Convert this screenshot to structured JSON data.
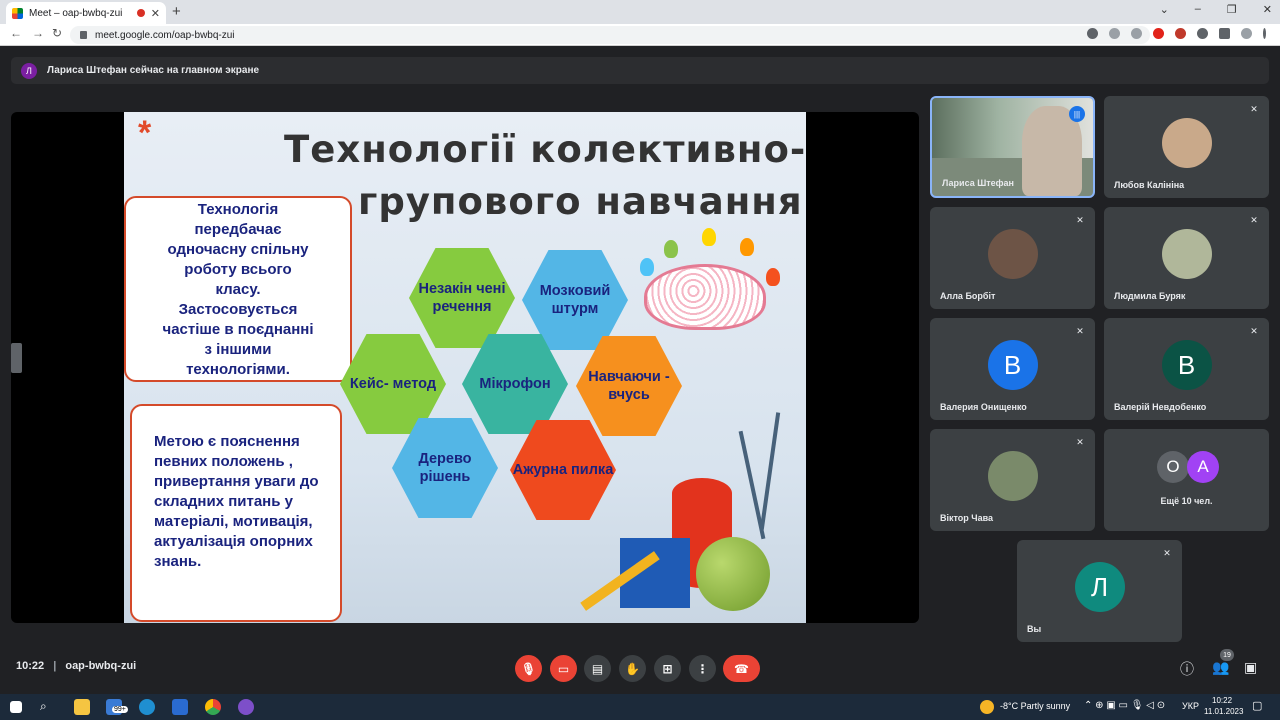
{
  "browser": {
    "tab_title": "Meet – oap-bwbq-zui",
    "tab_close": "✕",
    "new_tab": "+",
    "url": "meet.google.com/oap-bwbq-zui",
    "window_controls": [
      "⌄",
      "–",
      "❐",
      "✕"
    ]
  },
  "banner": {
    "avatar_letter": "Л",
    "text": "Лариса Штефан сейчас на главном экране"
  },
  "slide": {
    "title_line1": "Технології колективно-",
    "title_line2": "групового навчання",
    "panel1": [
      "Технологія",
      "передбачає",
      "одночасну спільну",
      "роботу  всього",
      "класу.",
      "Застосовується",
      "частіше в поєднанні",
      "з іншими",
      "технологіями."
    ],
    "panel2": [
      "Метою є пояснення",
      "певних положень ,",
      "привертання уваги до",
      "складних питань у",
      "матеріалі, мотивація,",
      "актуалізація опорних",
      "знань."
    ],
    "hexagons": [
      "Незакін чені речення",
      "Мозковий штурм",
      "Кейс- метод",
      "Мікрофон",
      "Навчаючи - вчусь",
      "Дерево рішень",
      "Ажурна пилка"
    ]
  },
  "participants": [
    {
      "name": "Лариса Штефан",
      "avatar": "",
      "color": "#9e8b7a"
    },
    {
      "name": "Любов Калініна",
      "avatar": "",
      "color": "#c9a98a"
    },
    {
      "name": "Алла Борбіт",
      "avatar": "",
      "color": "#6d5446"
    },
    {
      "name": "Людмила Буряк",
      "avatar": "",
      "color": "#b0b79a"
    },
    {
      "name": "Валерия Онищенко",
      "avatar": "B",
      "color": "#1a73e8"
    },
    {
      "name": "Валерій Невдобенко",
      "avatar": "B",
      "color": "#0b5345"
    },
    {
      "name": "Віктор Чава",
      "avatar": "",
      "color": "#7a8a6a"
    },
    {
      "name": "Ещё 10 чел.",
      "avatar": "",
      "color": "#3c4043"
    },
    {
      "name": "Вы",
      "avatar": "Л",
      "color": "#0f8a7e"
    }
  ],
  "more_avatars": [
    "O",
    "A"
  ],
  "meeting": {
    "time": "10:22",
    "divider": "|",
    "code": "oap-bwbq-zui",
    "people_count": "19"
  },
  "taskbar": {
    "weather": "-8°C  Partly sunny",
    "lang": "УКР",
    "time": "10:22",
    "date": "11.01.2023",
    "badge_99": "99+"
  }
}
